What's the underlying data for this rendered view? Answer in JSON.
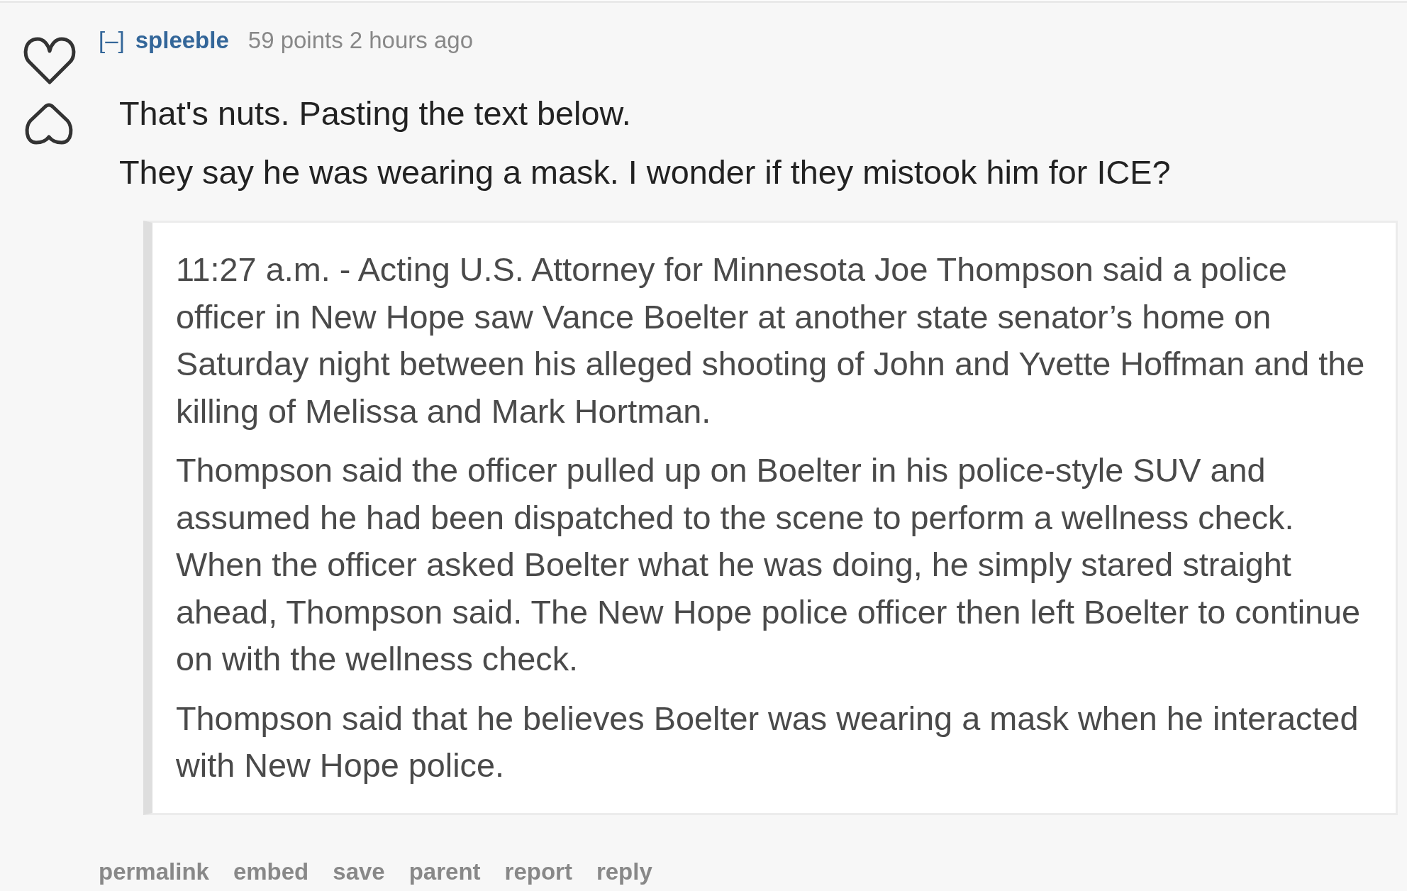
{
  "comment": {
    "collapse_toggle": "[–]",
    "author": "spleeble",
    "score": "59 points",
    "time": "2 hours ago",
    "body": [
      "That's nuts. Pasting the text below.",
      "They say he was wearing a mask. I wonder if they mistook him for ICE?"
    ],
    "quote": [
      "11:27 a.m. - Acting U.S. Attorney for Minnesota Joe Thompson said a police officer in New Hope saw Vance Boelter at another state senator’s home on Saturday night between his alleged shooting of John and Yvette Hoffman and the killing of Melissa and Mark Hortman.",
      "Thompson said the officer pulled up on Boelter in his police-style SUV and assumed he had been dispatched to the scene to perform a wellness check. When the officer asked Boelter what he was doing, he simply stared straight ahead, Thompson said. The New Hope police officer then left Boelter to continue on with the wellness check.",
      "Thompson said that he believes Boelter was wearing a mask when he interacted with New Hope police."
    ],
    "actions": [
      "permalink",
      "embed",
      "save",
      "parent",
      "report",
      "reply"
    ]
  }
}
